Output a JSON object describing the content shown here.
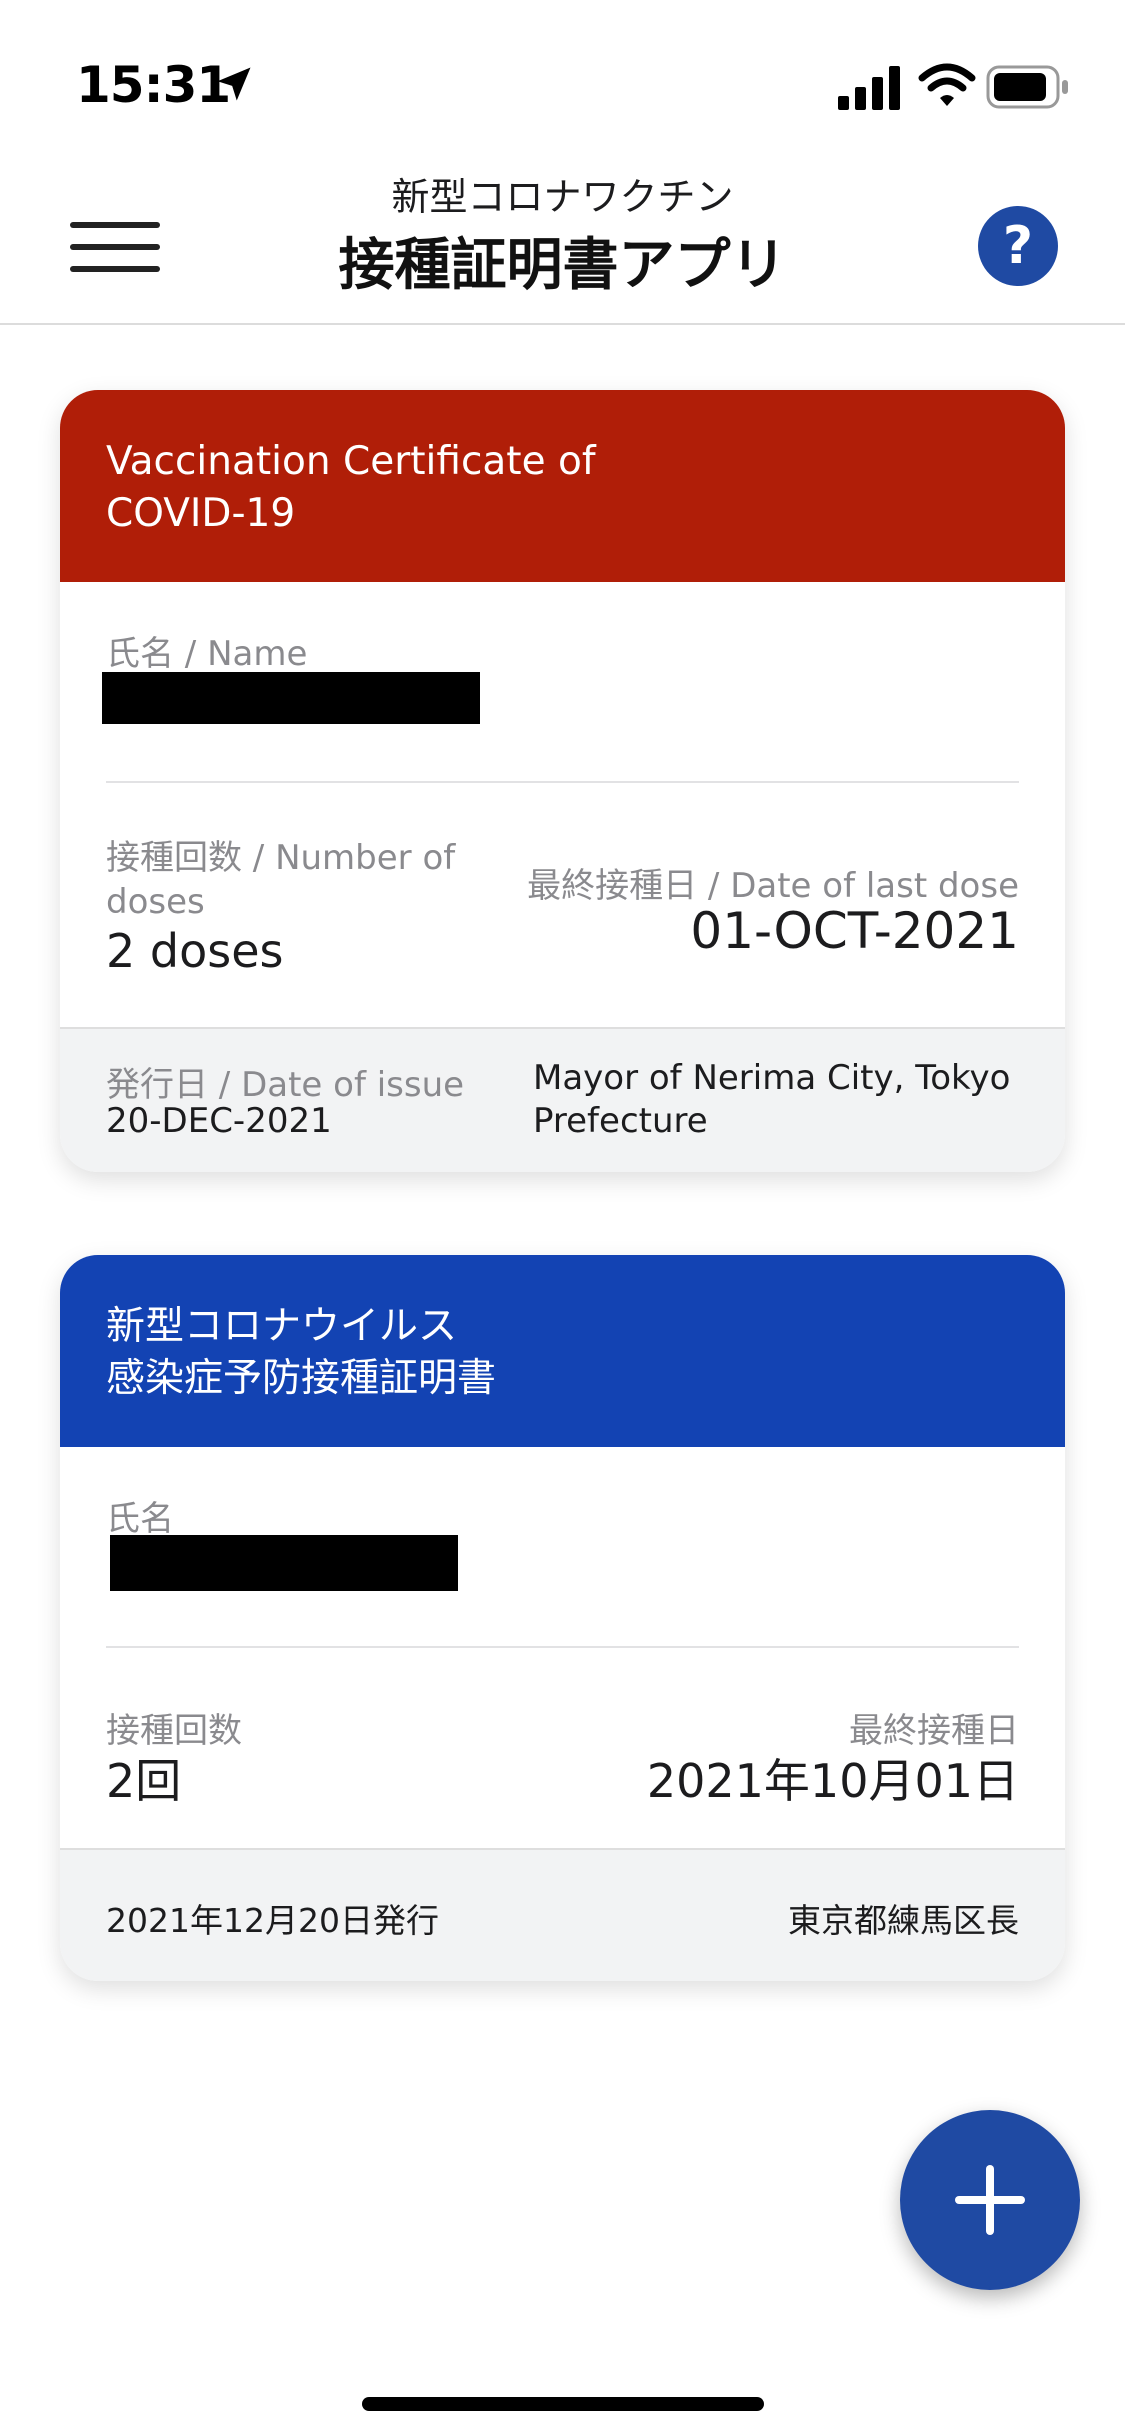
{
  "status_bar": {
    "time": "15:31"
  },
  "header": {
    "subtitle": "新型コロナワクチン",
    "title": "接種証明書アプリ",
    "help_label": "?"
  },
  "certificates": [
    {
      "header_color": "#b01e08",
      "title_line1": "Vaccination Certificate of",
      "title_line2": "COVID-19",
      "name_label": "氏名 / Name",
      "doses_label": "接種回数 / Number of doses",
      "doses_value": "2 doses",
      "last_dose_label": "最終接種日 / Date of last dose",
      "last_dose_value": "01-OCT-2021",
      "issue_label": "発行日 / Date of issue",
      "issue_value": "20-DEC-2021",
      "issuer": "Mayor of Nerima City, Tokyo Prefecture"
    },
    {
      "header_color": "#1343b3",
      "title_line1": "新型コロナウイルス",
      "title_line2": "感染症予防接種証明書",
      "name_label": "氏名",
      "doses_label": "接種回数",
      "doses_value": "2回",
      "last_dose_label": "最終接種日",
      "last_dose_value": "2021年10月01日",
      "issue_value": "2021年12月20日発行",
      "issuer": "東京都練馬区長"
    }
  ],
  "icons": {
    "location": "location-arrow-icon",
    "signal": "cellular-signal-icon",
    "wifi": "wifi-icon",
    "battery": "battery-icon",
    "menu": "hamburger-menu-icon",
    "help": "question-mark-icon",
    "add": "plus-icon"
  },
  "colors": {
    "accent": "#1f4aa3",
    "card_red": "#b01e08",
    "card_blue": "#1343b3"
  }
}
